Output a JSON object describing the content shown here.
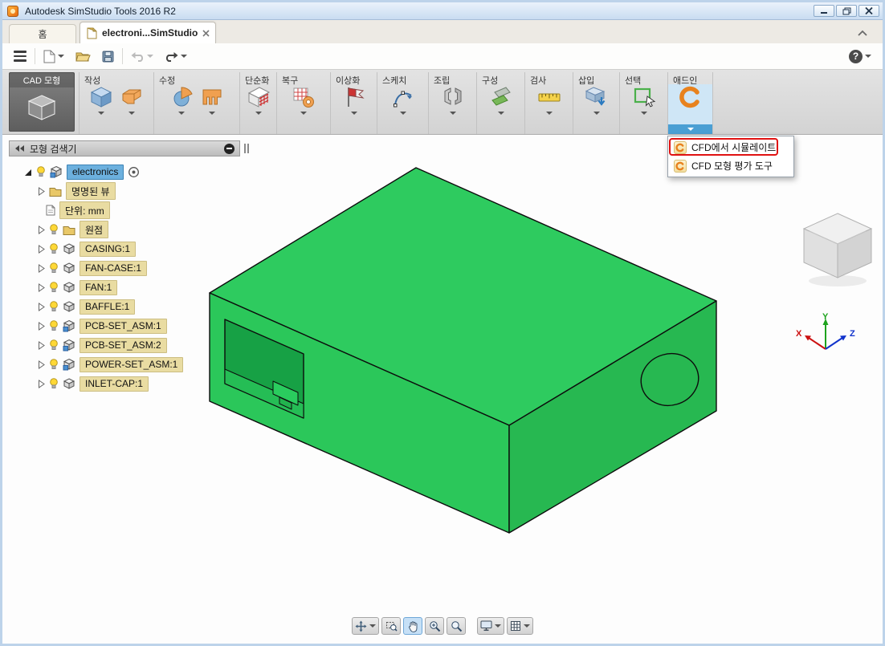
{
  "window": {
    "title": "Autodesk SimStudio Tools 2016 R2"
  },
  "tabs": {
    "home": "홈",
    "document": "electroni...SimStudio"
  },
  "ribbon": {
    "cad_model": "CAD 모형",
    "groups": [
      "작성",
      "수정",
      "단순화",
      "복구",
      "이상화",
      "스케치",
      "조립",
      "구성",
      "검사",
      "삽입",
      "선택",
      "애드인"
    ]
  },
  "addin_menu": {
    "items": [
      {
        "label": "CFD에서 시뮬레이트"
      },
      {
        "label": "CFD 모형 평가 도구"
      }
    ]
  },
  "browser": {
    "title": "모형 검색기",
    "items": [
      {
        "label": "electronics"
      },
      {
        "label": "명명된 뷰"
      },
      {
        "label": "단위: mm"
      },
      {
        "label": "원점"
      },
      {
        "label": "CASING:1"
      },
      {
        "label": "FAN-CASE:1"
      },
      {
        "label": "FAN:1"
      },
      {
        "label": "BAFFLE:1"
      },
      {
        "label": "PCB-SET_ASM:1"
      },
      {
        "label": "PCB-SET_ASM:2"
      },
      {
        "label": "POWER-SET_ASM:1"
      },
      {
        "label": "INLET-CAP:1"
      }
    ]
  },
  "triad": {
    "x": "X",
    "y": "Y",
    "z": "Z"
  },
  "colors": {
    "model_green_top": "#2ecb5f",
    "model_green_left": "#2bc75a",
    "model_green_right": "#27b851",
    "accent_blue": "#4a9fd4",
    "selection_blue": "#6cb0de",
    "highlight_red": "#e01212",
    "tree_label_tan": "#e9dca2"
  }
}
